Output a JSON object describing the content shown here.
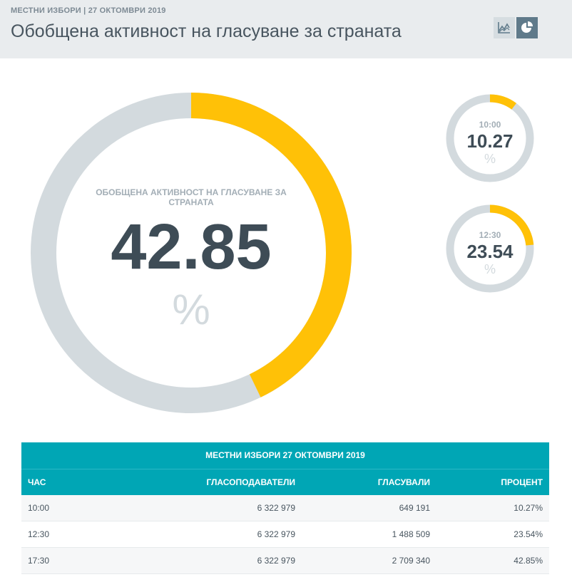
{
  "header": {
    "breadcrumb": "МЕСТНИ ИЗБОРИ | 27 ОКТОМВРИ 2019",
    "title": "Обобщена активност на гласуване за страната",
    "view_toggle": {
      "line_icon": "line-chart-icon",
      "pie_icon": "pie-chart-icon",
      "active": "pie"
    }
  },
  "colors": {
    "accent": "#ffc107",
    "track": "#d3dade",
    "table_header": "#00a6b5",
    "value_text": "#3e4c56"
  },
  "main_gauge": {
    "label": "ОБОБЩЕНА АКТИВНОСТ НА ГЛАСУВАНЕ ЗА СТРАНАТА",
    "value": "42.85",
    "unit": "%",
    "percent": 42.85
  },
  "small_gauges": [
    {
      "time": "10:00",
      "value": "10.27",
      "unit": "%",
      "percent": 10.27
    },
    {
      "time": "12:30",
      "value": "23.54",
      "unit": "%",
      "percent": 23.54
    }
  ],
  "table": {
    "caption": "МЕСТНИ ИЗБОРИ 27 ОКТОМВРИ 2019",
    "columns": [
      "ЧАС",
      "ГЛАСОПОДАВАТЕЛИ",
      "ГЛАСУВАЛИ",
      "ПРОЦЕНТ"
    ],
    "rows": [
      [
        "10:00",
        "6 322 979",
        "649 191",
        "10.27%"
      ],
      [
        "12:30",
        "6 322 979",
        "1 488 509",
        "23.54%"
      ],
      [
        "17:30",
        "6 322 979",
        "2 709 340",
        "42.85%"
      ]
    ]
  }
}
